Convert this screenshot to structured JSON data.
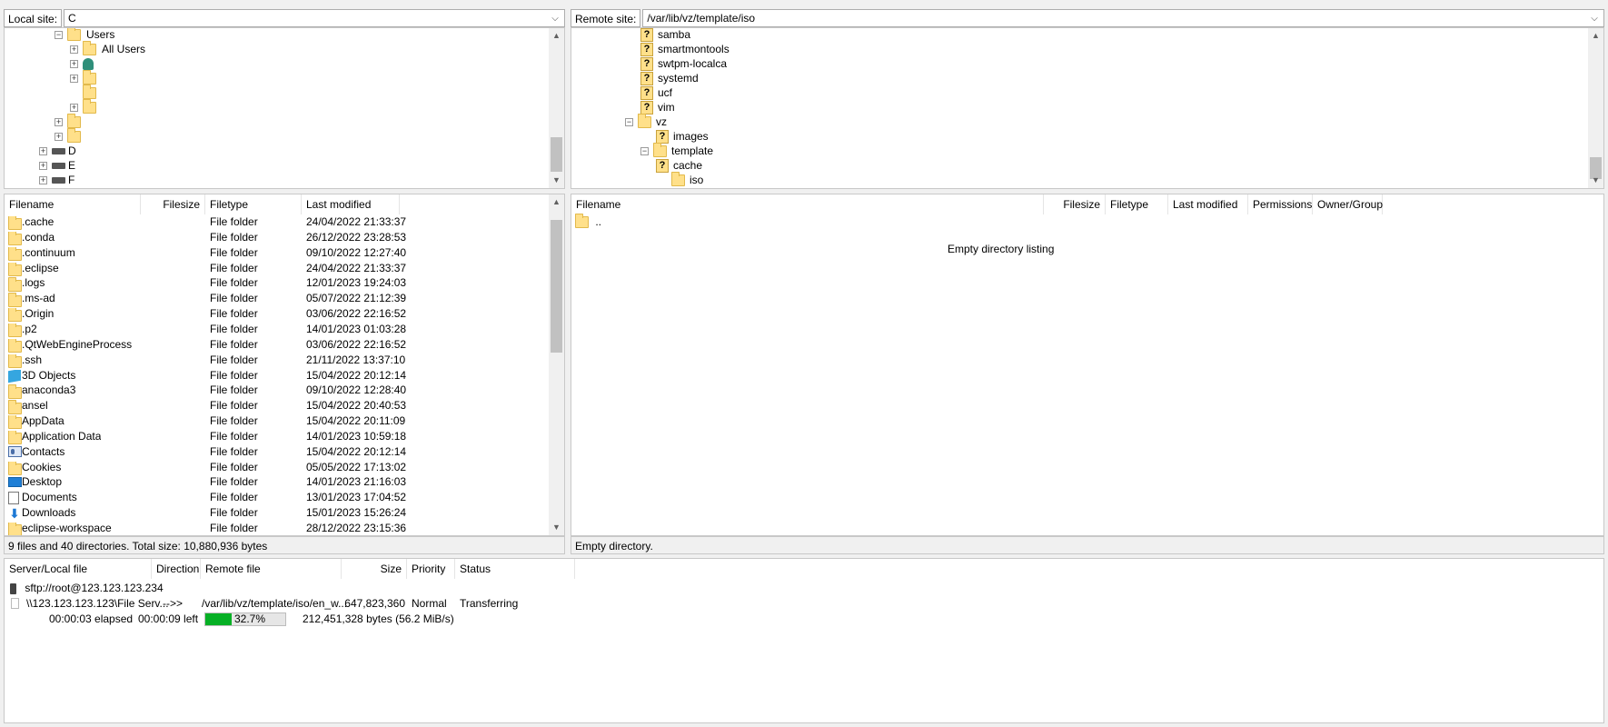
{
  "local_site": {
    "label": "Local site:",
    "value": "C"
  },
  "remote_site": {
    "label": "Remote site:",
    "value": "/var/lib/vz/template/iso"
  },
  "local_tree": {
    "users": "Users",
    "all_users": "All Users",
    "drive_d": "D",
    "drive_e": "E",
    "drive_f": "F"
  },
  "remote_tree": [
    "samba",
    "smartmontools",
    "swtpm-localca",
    "systemd",
    "ucf",
    "vim",
    "vz",
    "images",
    "template",
    "cache",
    "iso"
  ],
  "local_list": {
    "headers": {
      "name": "Filename",
      "size": "Filesize",
      "type": "Filetype",
      "modified": "Last modified"
    },
    "rows": [
      {
        "name": ".cache",
        "type": "File folder",
        "modified": "24/04/2022 21:33:37",
        "icon": "folder-icon"
      },
      {
        "name": ".conda",
        "type": "File folder",
        "modified": "26/12/2022 23:28:53",
        "icon": "folder-icon"
      },
      {
        "name": ".continuum",
        "type": "File folder",
        "modified": "09/10/2022 12:27:40",
        "icon": "folder-icon"
      },
      {
        "name": ".eclipse",
        "type": "File folder",
        "modified": "24/04/2022 21:33:37",
        "icon": "folder-icon"
      },
      {
        "name": ".logs",
        "type": "File folder",
        "modified": "12/01/2023 19:24:03",
        "icon": "folder-icon"
      },
      {
        "name": ".ms-ad",
        "type": "File folder",
        "modified": "05/07/2022 21:12:39",
        "icon": "folder-icon"
      },
      {
        "name": ".Origin",
        "type": "File folder",
        "modified": "03/06/2022 22:16:52",
        "icon": "folder-icon"
      },
      {
        "name": ".p2",
        "type": "File folder",
        "modified": "14/01/2023 01:03:28",
        "icon": "folder-icon"
      },
      {
        "name": ".QtWebEngineProcess",
        "type": "File folder",
        "modified": "03/06/2022 22:16:52",
        "icon": "folder-icon"
      },
      {
        "name": ".ssh",
        "type": "File folder",
        "modified": "21/11/2022 13:37:10",
        "icon": "folder-icon"
      },
      {
        "name": "3D Objects",
        "type": "File folder",
        "modified": "15/04/2022 20:12:14",
        "icon": "3d-objects-icon"
      },
      {
        "name": "anaconda3",
        "type": "File folder",
        "modified": "09/10/2022 12:28:40",
        "icon": "folder-icon"
      },
      {
        "name": "ansel",
        "type": "File folder",
        "modified": "15/04/2022 20:40:53",
        "icon": "folder-icon"
      },
      {
        "name": "AppData",
        "type": "File folder",
        "modified": "15/04/2022 20:11:09",
        "icon": "folder-icon"
      },
      {
        "name": "Application Data",
        "type": "File folder",
        "modified": "14/01/2023 10:59:18",
        "icon": "folder-icon"
      },
      {
        "name": "Contacts",
        "type": "File folder",
        "modified": "15/04/2022 20:12:14",
        "icon": "contacts-icon"
      },
      {
        "name": "Cookies",
        "type": "File folder",
        "modified": "05/05/2022 17:13:02",
        "icon": "folder-icon"
      },
      {
        "name": "Desktop",
        "type": "File folder",
        "modified": "14/01/2023 21:16:03",
        "icon": "desktop-icon"
      },
      {
        "name": "Documents",
        "type": "File folder",
        "modified": "13/01/2023 17:04:52",
        "icon": "documents-icon"
      },
      {
        "name": "Downloads",
        "type": "File folder",
        "modified": "15/01/2023 15:26:24",
        "icon": "downloads-icon"
      },
      {
        "name": "eclipse-workspace",
        "type": "File folder",
        "modified": "28/12/2022 23:15:36",
        "icon": "folder-icon"
      }
    ],
    "status": "9 files and 40 directories. Total size: 10,880,936 bytes"
  },
  "remote_list": {
    "headers": {
      "name": "Filename",
      "size": "Filesize",
      "type": "Filetype",
      "modified": "Last modified",
      "perms": "Permissions",
      "owner": "Owner/Group"
    },
    "parent": "..",
    "empty_msg": "Empty directory listing",
    "status": "Empty directory."
  },
  "queue": {
    "headers": {
      "server": "Server/Local file",
      "direction": "Direction",
      "remote": "Remote file",
      "size": "Size",
      "priority": "Priority",
      "status": "Status"
    },
    "server": "sftp://root@123.123.123.234",
    "item": {
      "local": "\\\\123.123.123.123\\File Serv...",
      "direction": "-->>",
      "remote": "/var/lib/vz/template/iso/en_w...",
      "size": "647,823,360",
      "priority": "Normal",
      "status": "Transferring"
    },
    "elapsed": "00:00:03 elapsed",
    "left": "00:00:09 left",
    "progress_percent": 32.7,
    "progress_label": "32.7%",
    "bytes": "212,451,328 bytes (56.2 MiB/s)",
    "progress_color": "#06b025"
  }
}
